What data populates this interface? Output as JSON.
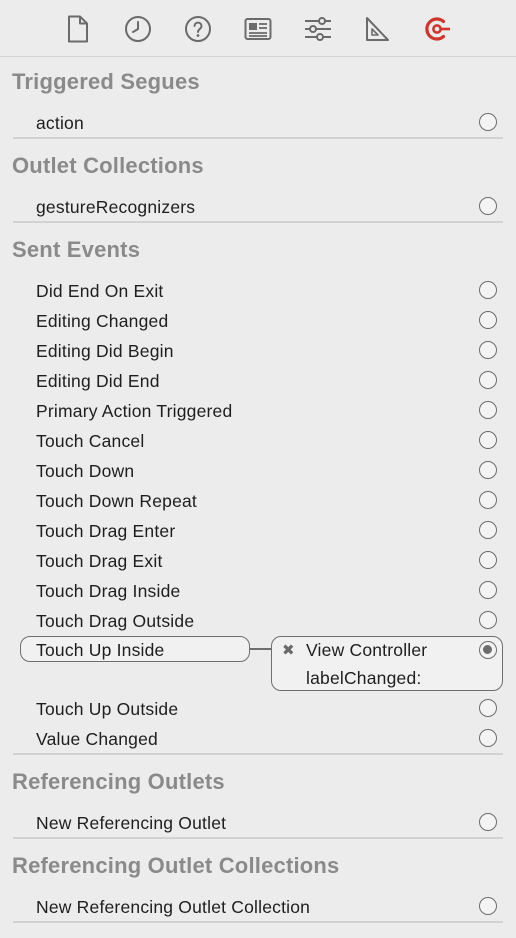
{
  "toolbar": {
    "icons": [
      "file-icon",
      "history-icon",
      "help-icon",
      "identity-icon",
      "attributes-icon",
      "size-ruler-icon",
      "connections-icon"
    ],
    "active_color": "#d0342c",
    "inactive_color": "#6b6b6b"
  },
  "sections": {
    "triggered_segues": {
      "title": "Triggered Segues",
      "items": [
        "action"
      ]
    },
    "outlet_collections": {
      "title": "Outlet Collections",
      "items": [
        "gestureRecognizers"
      ]
    },
    "sent_events": {
      "title": "Sent Events",
      "items": [
        "Did End On Exit",
        "Editing Changed",
        "Editing Did Begin",
        "Editing Did End",
        "Primary Action Triggered",
        "Touch Cancel",
        "Touch Down",
        "Touch Down Repeat",
        "Touch Drag Enter",
        "Touch Drag Exit",
        "Touch Drag Inside",
        "Touch Drag Outside",
        "Touch Up Inside",
        "Touch Up Outside",
        "Value Changed"
      ],
      "connection": {
        "target": "View Controller",
        "action": "labelChanged:",
        "remove_glyph": "✖"
      }
    },
    "referencing_outlets": {
      "title": "Referencing Outlets",
      "items": [
        "New Referencing Outlet"
      ]
    },
    "referencing_outlet_collections": {
      "title": "Referencing Outlet Collections",
      "items": [
        "New Referencing Outlet Collection"
      ]
    }
  }
}
